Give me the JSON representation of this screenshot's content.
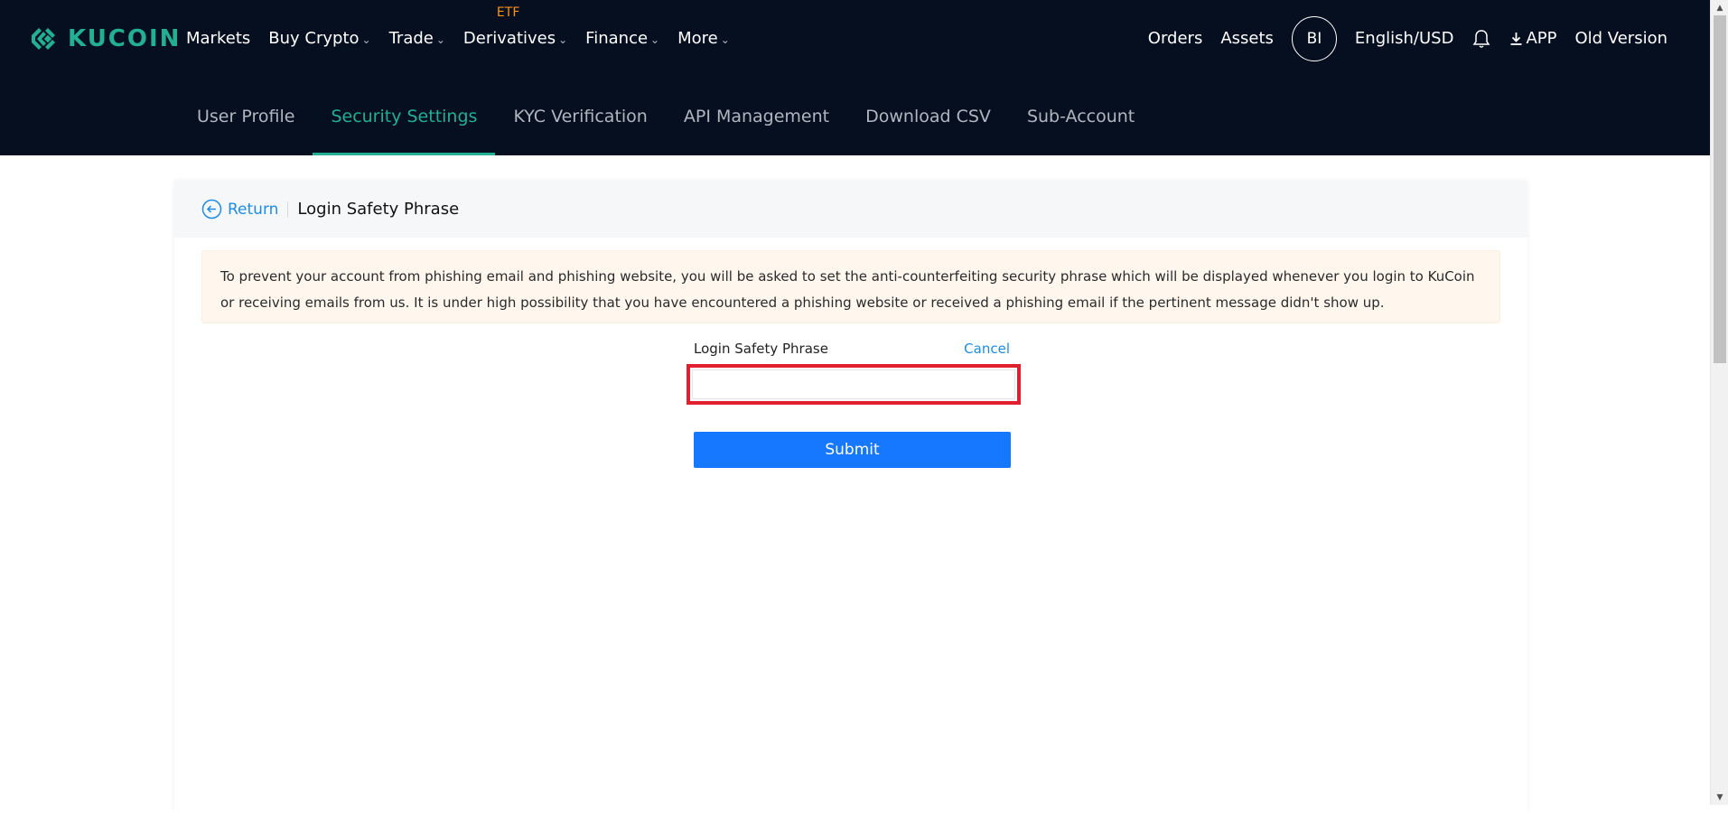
{
  "header": {
    "logo_text": "KUCOIN",
    "nav_left": [
      {
        "label": "Markets",
        "has_caret": false
      },
      {
        "label": "Buy Crypto",
        "has_caret": true
      },
      {
        "label": "Trade",
        "has_caret": true
      },
      {
        "label": "Derivatives",
        "has_caret": true
      },
      {
        "label": "Finance",
        "has_caret": true
      },
      {
        "label": "More",
        "has_caret": true
      }
    ],
    "etf_tag": "ETF",
    "orders": "Orders",
    "assets": "Assets",
    "avatar": "BI",
    "language": "English/USD",
    "app": "APP",
    "old_version": "Old Version"
  },
  "tabs": [
    {
      "label": "User Profile",
      "active": false
    },
    {
      "label": "Security Settings",
      "active": true
    },
    {
      "label": "KYC Verification",
      "active": false
    },
    {
      "label": "API Management",
      "active": false
    },
    {
      "label": "Download CSV",
      "active": false
    },
    {
      "label": "Sub-Account",
      "active": false
    }
  ],
  "card": {
    "return_label": "Return",
    "title": "Login Safety Phrase",
    "notice": "To prevent your account from phishing email and phishing website, you will be asked to set the anti-counterfeiting security phrase which will be displayed whenever you login to KuCoin or receiving emails from us. It is under high possibility that you have encountered a phishing website or received a phishing email if the pertinent message didn't show up.",
    "form": {
      "label": "Login Safety Phrase",
      "cancel": "Cancel",
      "input_value": "",
      "submit": "Submit"
    }
  },
  "colors": {
    "header_bg": "#060f1f",
    "brand": "#23af91",
    "link": "#1f8ce0",
    "primary_button": "#1677ff",
    "highlight_border": "#e0202e",
    "notice_bg": "#fff7ee"
  }
}
